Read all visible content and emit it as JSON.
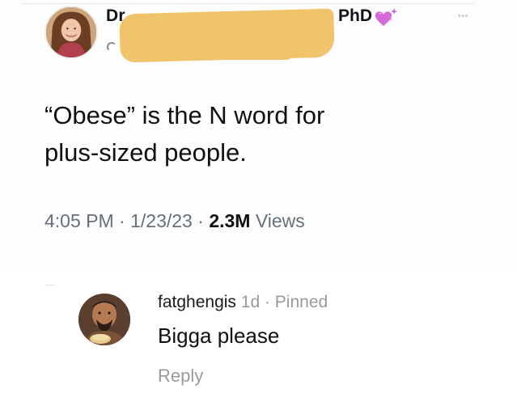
{
  "tweet": {
    "author_name": "Dr.",
    "author_credential": "PhD",
    "text_line_1": "“Obese” is the N word for",
    "text_line_2": "plus-sized people.",
    "time": "4:05 PM",
    "date": "1/23/23",
    "views_count": "2.3M",
    "views_label": "Views",
    "separator": " · "
  },
  "comment": {
    "username": "fatghengis",
    "age": "1d",
    "pinned_label": "Pinned",
    "separator": " · ",
    "body": "Bigga please",
    "reply_label": "Reply"
  },
  "icons": {
    "credential_badge": "sparkling-heart-icon",
    "menu": "more-options-icon"
  },
  "colors": {
    "redaction": "#f0c46a",
    "heart": "#d46bd6",
    "muted_text": "#64707a"
  }
}
